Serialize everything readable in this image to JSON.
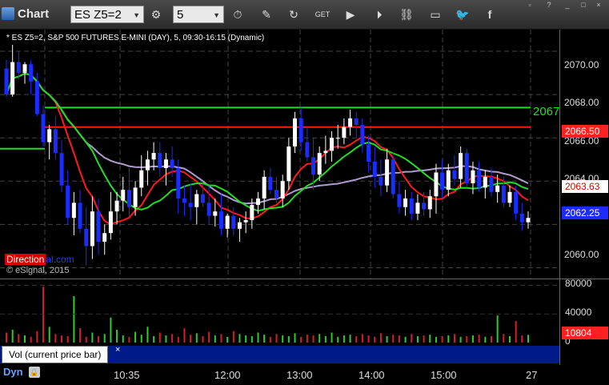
{
  "toolbar": {
    "app_title": "Chart",
    "symbol": "ES Z5=2",
    "interval": "5",
    "icons": [
      "settings-icon",
      "clock-icon",
      "pencil-icon",
      "refresh-icon",
      "get-icon",
      "play-icon",
      "link-icon",
      "chat-icon",
      "twitter-icon",
      "facebook-icon"
    ]
  },
  "chart": {
    "study_title": "* ES Z5=2, S&P 500 FUTURES E-MINI (DAY), 5, 09:30-16:15 (Dynamic)",
    "copyright": "© eSignal, 2015",
    "logo_red": "Direction",
    "logo_blue": "al.com",
    "price_labels": [
      "2070.00",
      "2068.00",
      "2066.00",
      "2064.00",
      "2062.00",
      "2060.00"
    ],
    "line_label": "2067",
    "tag_red": "2066.50",
    "tag_last": "2063.63",
    "tag_blue": "2062.25",
    "colors": {
      "up": "#ffffff",
      "down": "#1a2cff",
      "red_line": "#ff1a1a",
      "green_line": "#22dd22",
      "purple_line": "#b09bd0"
    }
  },
  "volume": {
    "title": "Vol (current price bar)",
    "close_label": "×",
    "axis_labels": [
      "80000",
      "40000",
      "0"
    ],
    "tag_value": "10804"
  },
  "time_axis": {
    "mode": "Dyn",
    "labels": [
      "10:35",
      "12:00",
      "13:00",
      "14:00",
      "15:00",
      "27"
    ]
  },
  "chart_data": {
    "type": "candlestick",
    "ylim": [
      2059.5,
      2071.0
    ],
    "bars": [
      [
        2069.2,
        2069.6,
        2067.9,
        2068.0
      ],
      [
        2068.0,
        2070.3,
        2067.9,
        2069.5
      ],
      [
        2069.5,
        2070.0,
        2068.7,
        2069.0
      ],
      [
        2069.0,
        2069.5,
        2068.5,
        2069.4
      ],
      [
        2069.4,
        2069.6,
        2068.0,
        2068.6
      ],
      [
        2068.6,
        2069.0,
        2067.0,
        2067.1
      ],
      [
        2067.1,
        2067.5,
        2065.6,
        2065.8
      ],
      [
        2065.8,
        2066.6,
        2065.0,
        2066.4
      ],
      [
        2066.4,
        2067.0,
        2065.0,
        2065.3
      ],
      [
        2065.3,
        2065.9,
        2063.5,
        2063.8
      ],
      [
        2063.8,
        2064.5,
        2062.0,
        2062.3
      ],
      [
        2062.3,
        2063.5,
        2061.5,
        2063.0
      ],
      [
        2063.0,
        2063.6,
        2061.6,
        2061.8
      ],
      [
        2061.8,
        2062.8,
        2060.1,
        2061.0
      ],
      [
        2061.0,
        2063.3,
        2060.4,
        2062.6
      ],
      [
        2062.6,
        2063.2,
        2060.6,
        2061.2
      ],
      [
        2061.2,
        2062.0,
        2060.6,
        2061.6
      ],
      [
        2061.6,
        2063.5,
        2061.3,
        2062.6
      ],
      [
        2062.6,
        2063.5,
        2062.0,
        2063.1
      ],
      [
        2063.1,
        2064.2,
        2062.6,
        2063.6
      ],
      [
        2063.6,
        2064.6,
        2062.4,
        2062.8
      ],
      [
        2062.8,
        2064.0,
        2062.4,
        2063.7
      ],
      [
        2063.7,
        2065.2,
        2063.3,
        2064.5
      ],
      [
        2064.5,
        2065.4,
        2063.8,
        2065.0
      ],
      [
        2065.0,
        2065.8,
        2064.5,
        2065.3
      ],
      [
        2065.3,
        2065.8,
        2064.2,
        2064.6
      ],
      [
        2064.6,
        2065.3,
        2063.8,
        2065.0
      ],
      [
        2065.0,
        2065.6,
        2064.2,
        2064.6
      ],
      [
        2064.6,
        2065.0,
        2062.5,
        2063.2
      ],
      [
        2063.2,
        2063.8,
        2062.4,
        2063.0
      ],
      [
        2063.0,
        2063.9,
        2062.2,
        2062.8
      ],
      [
        2062.8,
        2063.6,
        2062.0,
        2063.4
      ],
      [
        2063.4,
        2063.9,
        2062.8,
        2063.0
      ],
      [
        2063.0,
        2063.8,
        2062.0,
        2062.4
      ],
      [
        2062.4,
        2063.2,
        2061.9,
        2062.6
      ],
      [
        2062.6,
        2063.4,
        2061.5,
        2061.8
      ],
      [
        2061.8,
        2062.5,
        2061.4,
        2062.4
      ],
      [
        2062.4,
        2062.8,
        2061.5,
        2061.8
      ],
      [
        2061.8,
        2062.3,
        2061.2,
        2062.1
      ],
      [
        2062.1,
        2062.6,
        2061.6,
        2062.2
      ],
      [
        2062.2,
        2063.2,
        2061.8,
        2062.9
      ],
      [
        2062.9,
        2063.5,
        2062.5,
        2063.2
      ],
      [
        2063.2,
        2064.5,
        2062.7,
        2064.2
      ],
      [
        2064.2,
        2064.6,
        2063.4,
        2063.6
      ],
      [
        2063.6,
        2064.2,
        2063.0,
        2063.2
      ],
      [
        2063.2,
        2064.3,
        2062.8,
        2064.0
      ],
      [
        2064.0,
        2066.0,
        2063.6,
        2065.6
      ],
      [
        2065.6,
        2067.2,
        2065.3,
        2066.9
      ],
      [
        2066.9,
        2067.4,
        2065.4,
        2065.8
      ],
      [
        2065.8,
        2066.5,
        2064.9,
        2065.1
      ],
      [
        2065.1,
        2066.0,
        2063.6,
        2064.3
      ],
      [
        2064.3,
        2065.6,
        2064.0,
        2065.3
      ],
      [
        2065.3,
        2066.1,
        2064.8,
        2065.4
      ],
      [
        2065.4,
        2066.3,
        2064.9,
        2066.0
      ],
      [
        2066.0,
        2066.6,
        2065.5,
        2066.0
      ],
      [
        2066.0,
        2066.9,
        2065.7,
        2066.5
      ],
      [
        2066.5,
        2067.3,
        2066.1,
        2066.9
      ],
      [
        2066.9,
        2067.2,
        2066.0,
        2066.6
      ],
      [
        2066.6,
        2066.9,
        2065.3,
        2065.7
      ],
      [
        2065.7,
        2066.1,
        2064.4,
        2064.9
      ],
      [
        2064.9,
        2065.6,
        2063.7,
        2064.2
      ],
      [
        2064.2,
        2065.0,
        2063.3,
        2063.8
      ],
      [
        2063.8,
        2065.5,
        2063.5,
        2065.0
      ],
      [
        2065.0,
        2065.3,
        2063.2,
        2063.4
      ],
      [
        2063.4,
        2064.0,
        2062.5,
        2062.8
      ],
      [
        2062.8,
        2063.6,
        2062.4,
        2063.2
      ],
      [
        2063.2,
        2063.5,
        2062.2,
        2062.5
      ],
      [
        2062.5,
        2063.4,
        2062.2,
        2063.0
      ],
      [
        2063.0,
        2063.5,
        2062.4,
        2062.7
      ],
      [
        2062.7,
        2063.6,
        2062.3,
        2063.3
      ],
      [
        2063.3,
        2064.8,
        2062.5,
        2064.4
      ],
      [
        2064.4,
        2065.0,
        2063.2,
        2063.6
      ],
      [
        2063.6,
        2064.8,
        2063.3,
        2064.5
      ],
      [
        2064.5,
        2065.2,
        2063.8,
        2064.1
      ],
      [
        2064.1,
        2065.6,
        2063.7,
        2065.3
      ],
      [
        2065.3,
        2065.5,
        2063.7,
        2063.9
      ],
      [
        2063.9,
        2064.9,
        2063.4,
        2064.5
      ],
      [
        2064.5,
        2064.9,
        2063.5,
        2063.7
      ],
      [
        2063.7,
        2064.5,
        2063.2,
        2064.2
      ],
      [
        2064.2,
        2064.6,
        2063.3,
        2063.5
      ],
      [
        2063.5,
        2064.3,
        2063.0,
        2063.8
      ],
      [
        2063.8,
        2064.2,
        2062.8,
        2063.0
      ],
      [
        2063.0,
        2063.8,
        2062.8,
        2063.5
      ],
      [
        2063.5,
        2063.8,
        2062.2,
        2062.5
      ],
      [
        2062.5,
        2063.0,
        2061.7,
        2062.1
      ],
      [
        2062.1,
        2062.6,
        2061.8,
        2062.3
      ]
    ],
    "red_line_level": 2066.5,
    "green_line_level": 2067.4,
    "green_line_left_level": 2065.5,
    "volumes": [
      14000,
      18000,
      12000,
      10000,
      8000,
      16000,
      78000,
      22000,
      12000,
      10000,
      9000,
      65000,
      20000,
      8000,
      14000,
      9000,
      12000,
      35000,
      18000,
      10000,
      8000,
      15000,
      11000,
      22000,
      9000,
      14000,
      10000,
      12000,
      8000,
      20000,
      11000,
      13000,
      9000,
      15000,
      10000,
      12000,
      8000,
      16000,
      12000,
      10000,
      9000,
      14000,
      11000,
      8000,
      12000,
      10000,
      9000,
      13000,
      8000,
      11000,
      10000,
      12000,
      9000,
      14000,
      8000,
      10000,
      11000,
      9000,
      12000,
      10000,
      8000,
      13000,
      9000,
      11000,
      10000,
      8000,
      12000,
      9000,
      10000,
      11000,
      8000,
      9000,
      10000,
      12000,
      8000,
      9000,
      10000,
      11000,
      8000,
      9000,
      38000,
      12000,
      9000,
      30000,
      10000,
      10804
    ]
  }
}
